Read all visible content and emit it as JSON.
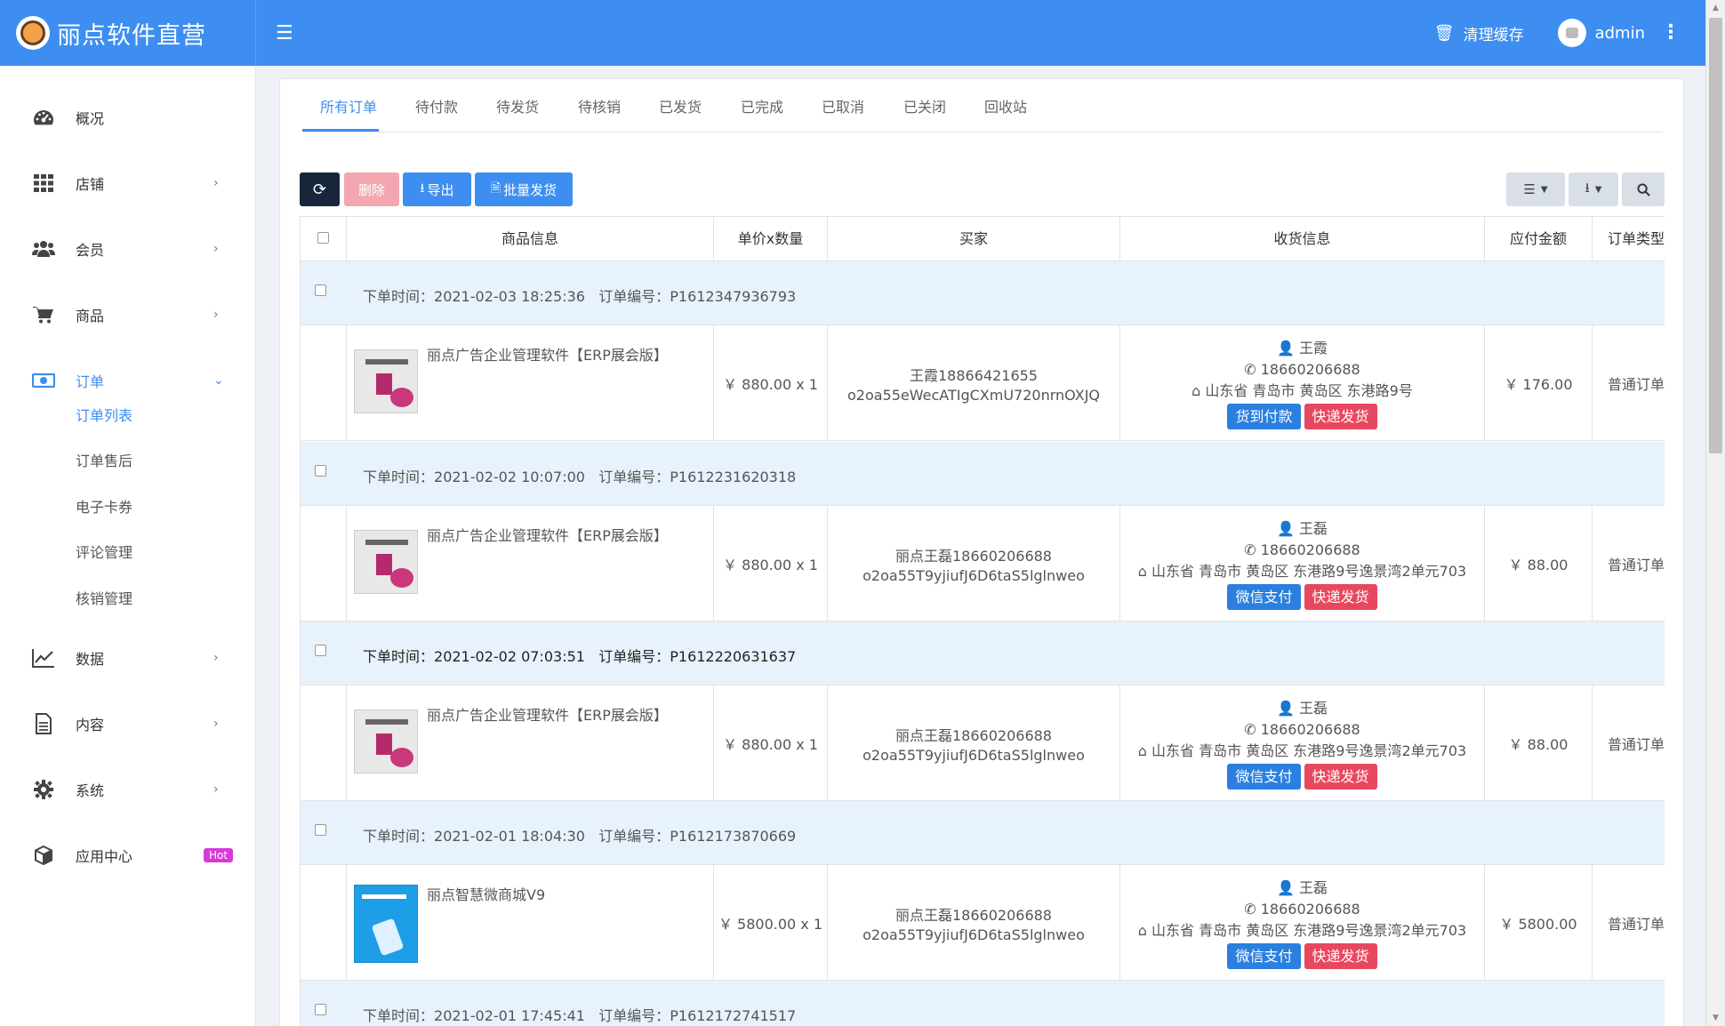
{
  "header": {
    "brand": "丽点软件直营",
    "clear_cache": "清理缓存",
    "user": "admin"
  },
  "sidebar": {
    "items": [
      {
        "label": "概况",
        "icon": "dashboard-icon"
      },
      {
        "label": "店铺",
        "icon": "grid-icon"
      },
      {
        "label": "会员",
        "icon": "users-icon"
      },
      {
        "label": "商品",
        "icon": "cart-icon"
      },
      {
        "label": "订单",
        "icon": "money-icon"
      },
      {
        "label": "数据",
        "icon": "chart-line-icon"
      },
      {
        "label": "内容",
        "icon": "document-icon"
      },
      {
        "label": "系统",
        "icon": "gear-icon"
      },
      {
        "label": "应用中心",
        "icon": "cube-icon"
      }
    ],
    "sub_items": [
      "订单列表",
      "订单售后",
      "电子卡券",
      "评论管理",
      "核销管理"
    ],
    "hot_badge": "Hot"
  },
  "tabs": [
    "所有订单",
    "待付款",
    "待发货",
    "待核销",
    "已发货",
    "已完成",
    "已取消",
    "已关闭",
    "回收站"
  ],
  "toolbar": {
    "delete": "删除",
    "export": "导出",
    "batch_ship": "批量发货"
  },
  "table": {
    "headers": [
      "商品信息",
      "单价x数量",
      "买家",
      "收货信息",
      "应付金额",
      "订单类型"
    ],
    "time_label": "下单时间：",
    "no_label": "订单编号：",
    "orders": [
      {
        "time": "2021-02-03 18:25:36",
        "no": "P1612347936793",
        "product": "丽点广告企业管理软件【ERP展会版】",
        "price": "￥ 880.00 x 1",
        "buyer_name": "王霞18866421655",
        "buyer_id": "o2oa55eWecATIgCXmU720nrnOXJQ",
        "receiver": "王霞",
        "phone": "18660206688",
        "address": "山东省 青岛市 黄岛区 东港路9号",
        "pay_tag": "货到付款",
        "ship_tag": "快递发货",
        "amount": "￥ 176.00",
        "type": "普通订单"
      },
      {
        "time": "2021-02-02 10:07:00",
        "no": "P1612231620318",
        "product": "丽点广告企业管理软件【ERP展会版】",
        "price": "￥ 880.00 x 1",
        "buyer_name": "丽点王磊18660206688",
        "buyer_id": "o2oa55T9yjiufJ6D6taS5lglnweo",
        "receiver": "王磊",
        "phone": "18660206688",
        "address": "山东省 青岛市 黄岛区 东港路9号逸景湾2单元703",
        "pay_tag": "微信支付",
        "ship_tag": "快递发货",
        "amount": "￥ 88.00",
        "type": "普通订单"
      },
      {
        "time": "2021-02-02 07:03:51",
        "no": "P1612220631637",
        "product": "丽点广告企业管理软件【ERP展会版】",
        "price": "￥ 880.00 x 1",
        "buyer_name": "丽点王磊18660206688",
        "buyer_id": "o2oa55T9yjiufJ6D6taS5lglnweo",
        "receiver": "王磊",
        "phone": "18660206688",
        "address": "山东省 青岛市 黄岛区 东港路9号逸景湾2单元703",
        "pay_tag": "微信支付",
        "ship_tag": "快递发货",
        "amount": "￥ 88.00",
        "type": "普通订单"
      },
      {
        "time": "2021-02-01 18:04:30",
        "no": "P1612173870669",
        "product": "丽点智慧微商城V9",
        "price": "￥ 5800.00 x 1",
        "buyer_name": "丽点王磊18660206688",
        "buyer_id": "o2oa55T9yjiufJ6D6taS5lglnweo",
        "receiver": "王磊",
        "phone": "18660206688",
        "address": "山东省 青岛市 黄岛区 东港路9号逸景湾2单元703",
        "pay_tag": "微信支付",
        "ship_tag": "快递发货",
        "amount": "￥ 5800.00",
        "type": "普通订单"
      },
      {
        "time": "2021-02-01 17:45:41",
        "no": "P1612172741517"
      }
    ]
  }
}
